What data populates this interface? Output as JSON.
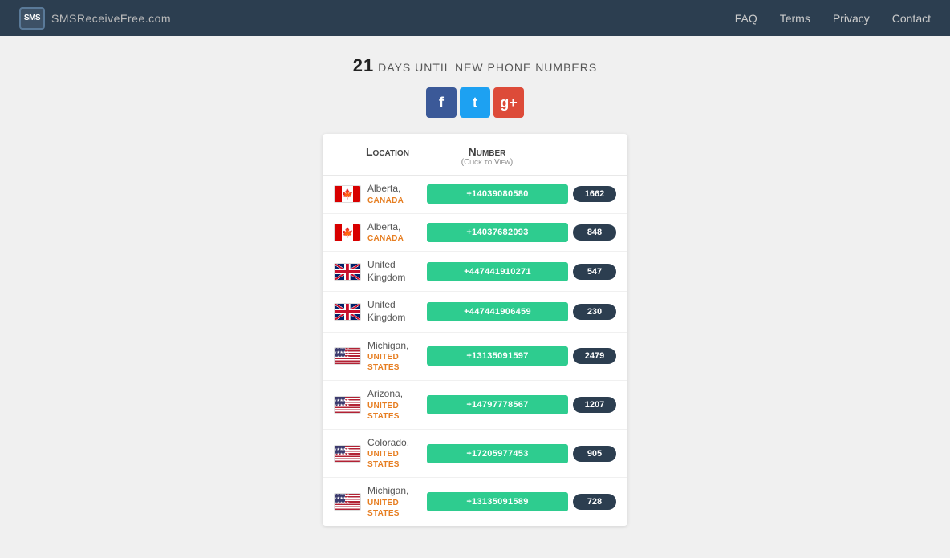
{
  "header": {
    "logo_icon": "SMS",
    "logo_brand": "SMS",
    "logo_suffix": "ReceiveFree.com",
    "nav": {
      "faq": "FAQ",
      "terms": "Terms",
      "privacy": "Privacy",
      "contact": "Contact"
    }
  },
  "countdown": {
    "days": "21",
    "label": "DAYS UNTIL NEW PHONE NUMBERS"
  },
  "social": {
    "facebook_label": "f",
    "twitter_label": "t",
    "google_label": "g+"
  },
  "table": {
    "col_location": "Location",
    "col_number": "Number",
    "col_click": "(Click to View)",
    "rows": [
      {
        "state": "Alberta,",
        "country": "CANADA",
        "flag": "canada",
        "phone": "+14039080580",
        "count": "1662"
      },
      {
        "state": "Alberta,",
        "country": "CANADA",
        "flag": "canada",
        "phone": "+14037682093",
        "count": "848"
      },
      {
        "state": "United Kingdom",
        "country": null,
        "flag": "uk",
        "phone": "+447441910271",
        "count": "547"
      },
      {
        "state": "United Kingdom",
        "country": null,
        "flag": "uk",
        "phone": "+447441906459",
        "count": "230"
      },
      {
        "state": "Michigan,",
        "country": "UNITED STATES",
        "flag": "us",
        "phone": "+13135091597",
        "count": "2479"
      },
      {
        "state": "Arizona,",
        "country": "UNITED STATES",
        "flag": "us",
        "phone": "+14797778567",
        "count": "1207"
      },
      {
        "state": "Colorado,",
        "country": "UNITED STATES",
        "flag": "us",
        "phone": "+17205977453",
        "count": "905"
      },
      {
        "state": "Michigan,",
        "country": "UNITED STATES",
        "flag": "us",
        "phone": "+13135091589",
        "count": "728"
      }
    ]
  }
}
